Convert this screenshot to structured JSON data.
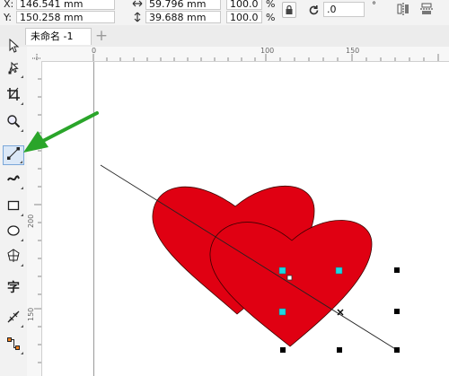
{
  "propbar": {
    "x_label": "X:",
    "x_value": "146.541 mm",
    "y_label": "Y:",
    "y_value": "150.258 mm",
    "w_value": "59.796 mm",
    "h_value": "39.688 mm",
    "scale_w": "100.0",
    "scale_h": "100.0",
    "pct": "%",
    "rotation": ".0",
    "degree": "°"
  },
  "tabs": {
    "doc_tab": "未命名 -1",
    "add_tab": "+"
  },
  "ruler_top": [
    "0",
    "100",
    "150"
  ],
  "ruler_left": [
    "200",
    "150"
  ],
  "toolbox": [
    {
      "name": "pick-tool-icon"
    },
    {
      "name": "shape-tool-icon"
    },
    {
      "name": "crop-tool-icon"
    },
    {
      "name": "zoom-tool-icon"
    },
    {
      "name": "line-tool-icon",
      "active": true
    },
    {
      "name": "artistic-media-icon"
    },
    {
      "name": "rectangle-tool-icon"
    },
    {
      "name": "ellipse-tool-icon"
    },
    {
      "name": "polygon-tool-icon"
    },
    {
      "name": "text-tool-icon",
      "label": "字"
    },
    {
      "name": "dimension-tool-icon"
    },
    {
      "name": "connector-tool-icon"
    }
  ],
  "colors": {
    "heart_fill": "#e00012",
    "handle_cyan": "#1fd6e0",
    "arrow_green": "#2aa52a"
  }
}
